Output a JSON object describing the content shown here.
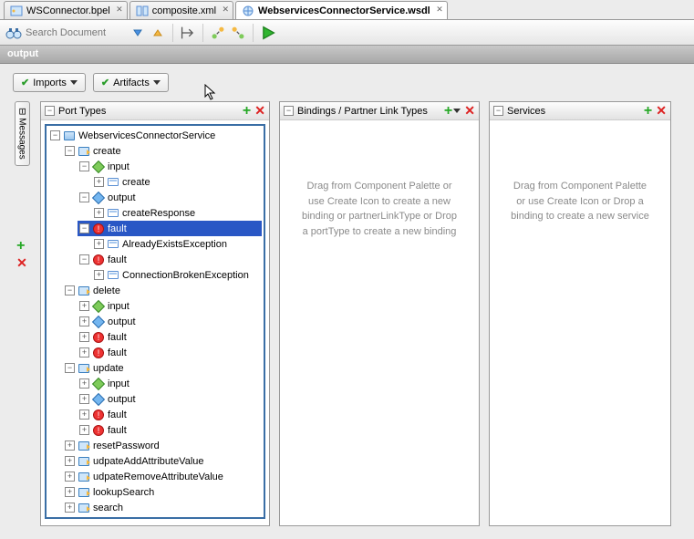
{
  "tabs": [
    {
      "label": "WSConnector.bpel"
    },
    {
      "label": "composite.xml"
    },
    {
      "label": "WebservicesConnectorService.wsdl"
    }
  ],
  "toolbar": {
    "search_placeholder": "Search Document"
  },
  "section_title": "output",
  "dropdowns": {
    "imports": "Imports",
    "artifacts": "Artifacts"
  },
  "side_tab": "Messages",
  "panels": {
    "port_types": {
      "title": "Port Types"
    },
    "bindings": {
      "title": "Bindings / Partner Link Types",
      "placeholder": "Drag from Component Palette or use Create Icon to create a new binding or partnerLinkType or Drop a portType to create a new binding"
    },
    "services": {
      "title": "Services",
      "placeholder": "Drag from Component Palette or use Create Icon or Drop a binding to create a new service"
    }
  },
  "tree": {
    "root": "WebservicesConnectorService",
    "create": {
      "label": "create",
      "input": "input",
      "input_msg": "create",
      "output": "output",
      "output_msg": "createResponse",
      "fault1": "fault",
      "fault1_msg": "AlreadyExistsException",
      "fault2": "fault",
      "fault2_msg": "ConnectionBrokenException"
    },
    "delete": {
      "label": "delete",
      "input": "input",
      "output": "output",
      "fault1": "fault",
      "fault2": "fault"
    },
    "update": {
      "label": "update",
      "input": "input",
      "output": "output",
      "fault1": "fault",
      "fault2": "fault"
    },
    "ops": {
      "resetPassword": "resetPassword",
      "udpateAdd": "udpateAddAttributeValue",
      "udpateRemove": "udpateRemoveAttributeValue",
      "lookupSearch": "lookupSearch",
      "search": "search"
    }
  }
}
